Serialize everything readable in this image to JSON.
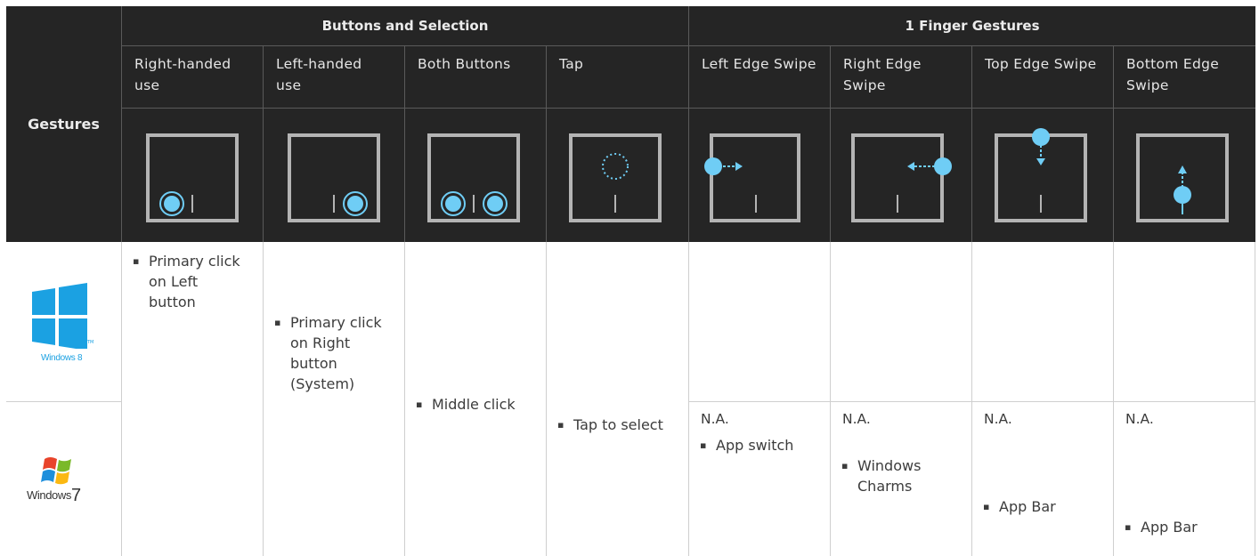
{
  "header": {
    "gestures_label": "Gestures",
    "group1": "Buttons and Selection",
    "group2": "1 Finger Gestures"
  },
  "columns": [
    {
      "title": "Right-handed use",
      "win8": "Primary click on Left button",
      "win7": ""
    },
    {
      "title": "Left-handed use",
      "win8": "Primary click on Right button (System)",
      "win7": ""
    },
    {
      "title": "Both Buttons",
      "win8": "Middle click",
      "win7": ""
    },
    {
      "title": "Tap",
      "win8": "Tap to select",
      "win7": ""
    },
    {
      "title": "Left Edge Swipe",
      "win8": "App switch",
      "win7": "N.A."
    },
    {
      "title": "Right Edge Swipe",
      "win8": "Windows Charms",
      "win7": "N.A."
    },
    {
      "title": "Top Edge Swipe",
      "win8": "App Bar",
      "win7": "N.A."
    },
    {
      "title": "Bottom Edge Swipe",
      "win8": "App Bar",
      "win7": "N.A."
    }
  ],
  "col_titles_lines": [
    [
      "Right-handed",
      "use"
    ],
    [
      "Left-handed",
      "use"
    ],
    [
      "Both Buttons"
    ],
    [
      "Tap"
    ],
    [
      "Left Edge Swipe"
    ],
    [
      "Right Edge",
      "Swipe"
    ],
    [
      "Top Edge Swipe"
    ],
    [
      "Bottom Edge",
      "Swipe"
    ]
  ],
  "win8_lines": [
    [
      "Primary click",
      "on Left",
      "button"
    ],
    [
      "Primary click",
      "on Right",
      "button",
      "(System)"
    ],
    [
      "Middle click"
    ],
    [
      "Tap to select"
    ],
    [
      "App switch"
    ],
    [
      "Windows",
      "Charms"
    ],
    [
      "App Bar"
    ],
    [
      "App Bar"
    ]
  ],
  "win7_na": [
    "N.A.",
    "N.A.",
    "N.A.",
    "N.A."
  ],
  "logos": {
    "win8_text": "Windows 8",
    "win8_tm": "TM",
    "win7_text": "Windows",
    "win7_num": "7"
  },
  "colors": {
    "dark_bg": "#252525",
    "accent": "#6fcdf5",
    "pad_border": "#b4b4b4",
    "win8_blue": "#1ba1e2"
  }
}
